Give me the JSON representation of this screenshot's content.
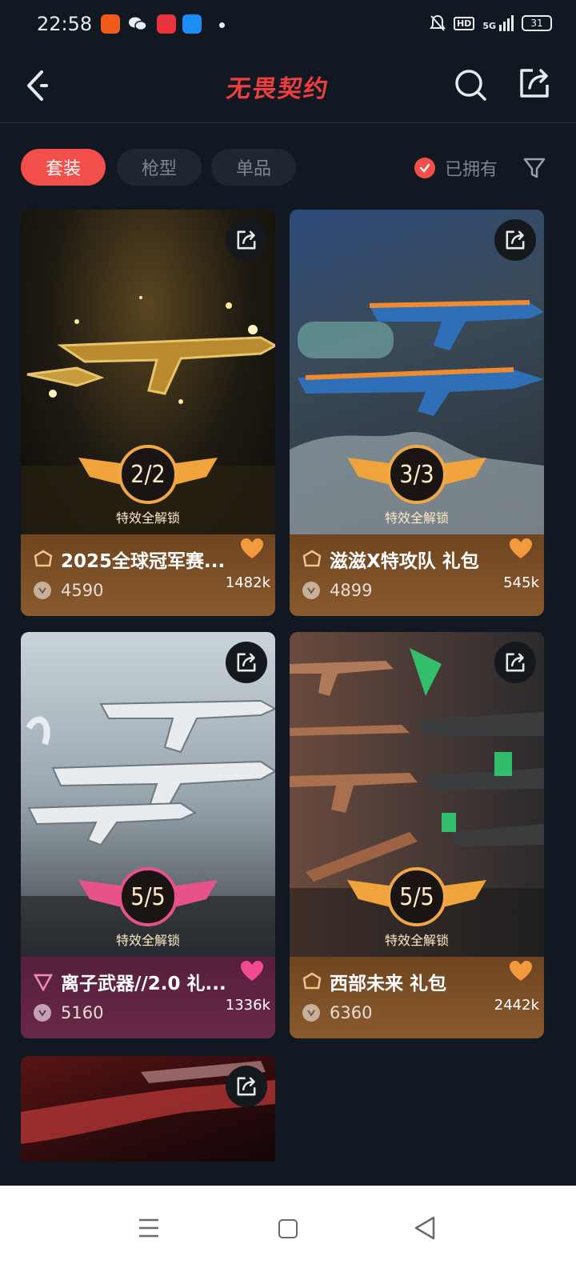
{
  "status_bar": {
    "time": "22:58",
    "hd": "HD",
    "signal": "5G",
    "battery": "31"
  },
  "header": {
    "logo": "无畏契约"
  },
  "filters": {
    "tabs": [
      {
        "label": "套装",
        "active": true
      },
      {
        "label": "枪型",
        "active": false
      },
      {
        "label": "单品",
        "active": false
      }
    ],
    "owned_label": "已拥有"
  },
  "cards": [
    {
      "title": "2025全球冠军赛...",
      "progress": "2/2",
      "unlock_label": "特效全解锁",
      "price": "4590",
      "likes": "1482k",
      "theme": "gold"
    },
    {
      "title": "滋滋X特攻队 礼包",
      "progress": "3/3",
      "unlock_label": "特效全解锁",
      "price": "4899",
      "likes": "545k",
      "theme": "gold"
    },
    {
      "title": "离子武器//2.0 礼...",
      "progress": "5/5",
      "unlock_label": "特效全解锁",
      "price": "5160",
      "likes": "1336k",
      "theme": "pink"
    },
    {
      "title": "西部未来 礼包",
      "progress": "5/5",
      "unlock_label": "特效全解锁",
      "price": "6360",
      "likes": "2442k",
      "theme": "gold"
    }
  ],
  "colors": {
    "accent": "#f24e4a",
    "background": "#111821",
    "gold_info": "#8a5a2e",
    "pink_info": "#6a2848"
  }
}
